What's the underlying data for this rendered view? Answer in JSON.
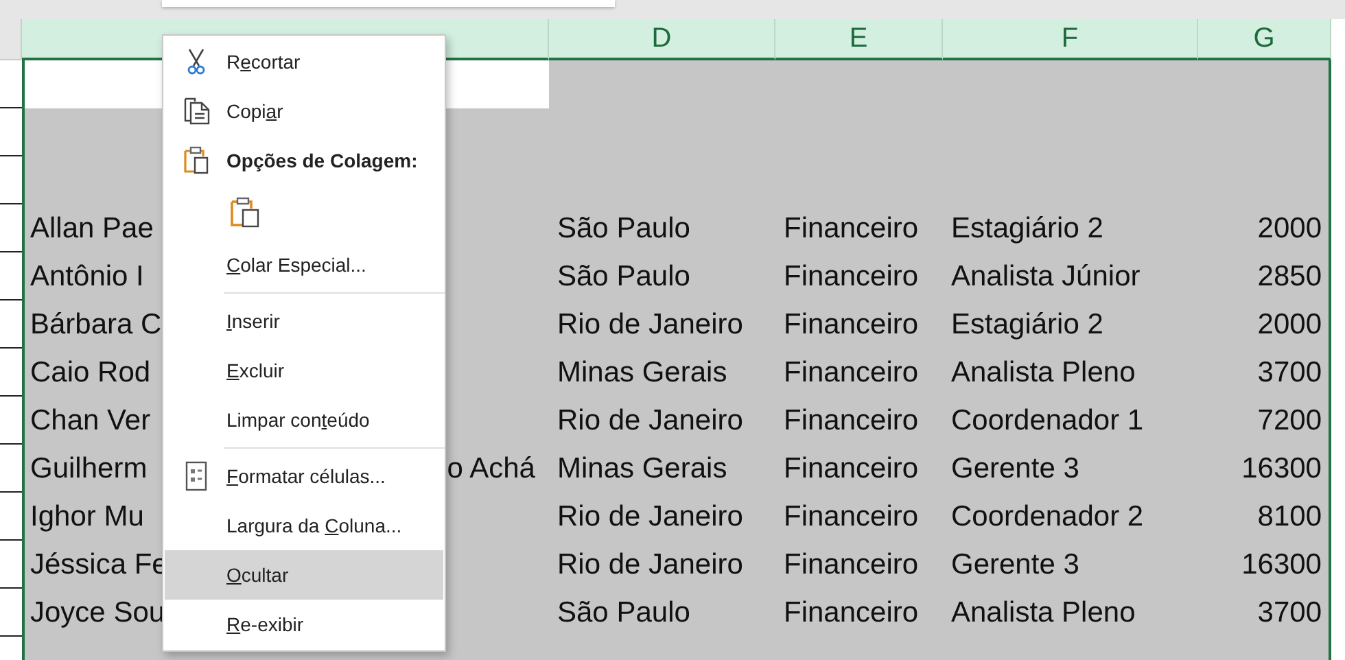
{
  "columns": [
    {
      "label": "D"
    },
    {
      "label": "E"
    },
    {
      "label": "F"
    },
    {
      "label": "G"
    }
  ],
  "rows": [
    {
      "c": [
        "Allan Pae"
      ],
      "d": "São Paulo",
      "e": "Financeiro",
      "f": "Estagiário 2",
      "g": "2000"
    },
    {
      "c": [
        "Antônio I"
      ],
      "d": "São Paulo",
      "e": "Financeiro",
      "f": "Analista Júnior",
      "g": "2850"
    },
    {
      "c": [
        "Bárbara C"
      ],
      "d": "Rio de Janeiro",
      "e": "Financeiro",
      "f": "Estagiário 2",
      "g": "2000"
    },
    {
      "c": [
        "Caio Rod"
      ],
      "d": "Minas Gerais",
      "e": "Financeiro",
      "f": "Analista Pleno",
      "g": "3700"
    },
    {
      "c": [
        "Chan Ver"
      ],
      "d": "Rio de Janeiro",
      "e": "Financeiro",
      "f": "Coordenador 1",
      "g": "7200"
    },
    {
      "c": [
        "Guilherm",
        "o Achá"
      ],
      "d": "Minas Gerais",
      "e": "Financeiro",
      "f": "Gerente 3",
      "g": "16300"
    },
    {
      "c": [
        "Ighor Mu"
      ],
      "d": "Rio de Janeiro",
      "e": "Financeiro",
      "f": "Coordenador 2",
      "g": "8100"
    },
    {
      "c": [
        "Jéssica Fe"
      ],
      "d": "Rio de Janeiro",
      "e": "Financeiro",
      "f": "Gerente 3",
      "g": "16300"
    },
    {
      "c": [
        "Joyce Sou"
      ],
      "d": "São Paulo",
      "e": "Financeiro",
      "f": "Analista Pleno",
      "g": "3700"
    }
  ],
  "context_menu": {
    "items": [
      {
        "kind": "command",
        "before": "R",
        "key": "e",
        "after": "cortar",
        "selected": false
      },
      {
        "kind": "command",
        "before": "Copi",
        "key": "a",
        "after": "r",
        "selected": false
      },
      {
        "kind": "heading",
        "label": "Opções de Colagem:"
      },
      {
        "kind": "paste-options"
      },
      {
        "kind": "command",
        "key": "C",
        "after": "olar Especial...",
        "selected": false
      },
      {
        "kind": "separator"
      },
      {
        "kind": "command",
        "key": "I",
        "after": "nserir",
        "selected": false
      },
      {
        "kind": "command",
        "key": "E",
        "after": "xcluir",
        "selected": false
      },
      {
        "kind": "command",
        "before": "Limpar con",
        "key": "t",
        "after": "eúdo",
        "selected": false
      },
      {
        "kind": "separator"
      },
      {
        "kind": "command",
        "key": "F",
        "after": "ormatar células...",
        "selected": false
      },
      {
        "kind": "command",
        "before": "Largura da ",
        "key": "C",
        "after": "oluna...",
        "selected": false
      },
      {
        "kind": "command",
        "key": "O",
        "after": "cultar",
        "selected": true
      },
      {
        "kind": "command",
        "key": "R",
        "after": "e-exibir",
        "selected": false
      }
    ]
  }
}
